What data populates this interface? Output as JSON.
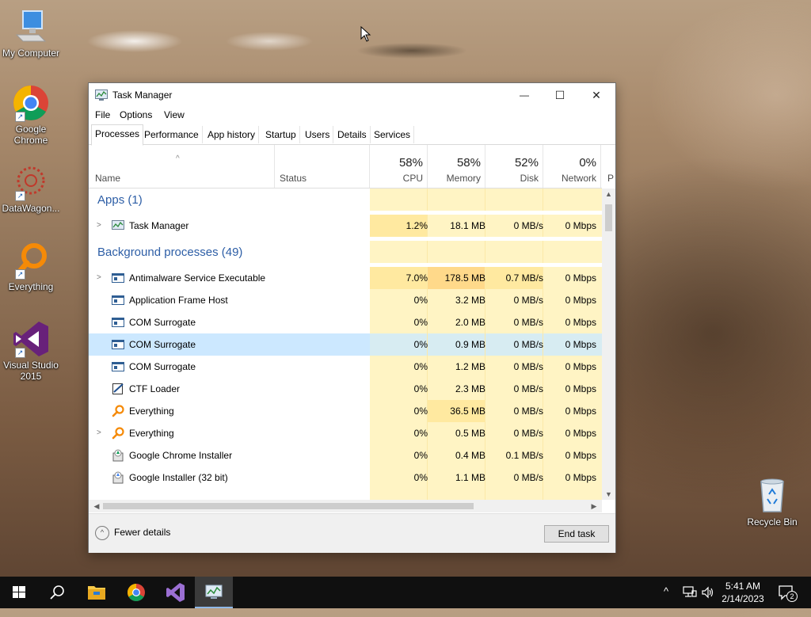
{
  "desktop": {
    "icons": [
      {
        "label": "My Computer"
      },
      {
        "label": "Google Chrome"
      },
      {
        "label": "DataWagon..."
      },
      {
        "label": "Everything"
      },
      {
        "label": "Visual Studio 2015"
      },
      {
        "label": "Recycle Bin"
      }
    ]
  },
  "window": {
    "title": "Task Manager",
    "icon": "task-manager-icon",
    "controls": {
      "minimize": "—",
      "maximize": "☐",
      "close": "✕"
    }
  },
  "menu": {
    "file": "File",
    "options": "Options",
    "view": "View"
  },
  "tabs": {
    "processes": "Processes",
    "performance": "Performance",
    "app_history": "App history",
    "startup": "Startup",
    "users": "Users",
    "details": "Details",
    "services": "Services"
  },
  "columns": {
    "name": "Name",
    "status": "Status",
    "cpu": {
      "pct": "58%",
      "label": "CPU"
    },
    "memory": {
      "pct": "58%",
      "label": "Memory"
    },
    "disk": {
      "pct": "52%",
      "label": "Disk"
    },
    "network": {
      "pct": "0%",
      "label": "Network"
    },
    "power_partial": "P"
  },
  "groups": {
    "apps": "Apps (1)",
    "background": "Background processes (49)"
  },
  "apps": [
    {
      "name": "Task Manager",
      "cpu": "1.2%",
      "memory": "18.1 MB",
      "disk": "0 MB/s",
      "network": "0 Mbps"
    }
  ],
  "processes": [
    {
      "name": "Antimalware Service Executable",
      "cpu": "7.0%",
      "memory": "178.5 MB",
      "disk": "0.7 MB/s",
      "network": "0 Mbps"
    },
    {
      "name": "Application Frame Host",
      "cpu": "0%",
      "memory": "3.2 MB",
      "disk": "0 MB/s",
      "network": "0 Mbps"
    },
    {
      "name": "COM Surrogate",
      "cpu": "0%",
      "memory": "2.0 MB",
      "disk": "0 MB/s",
      "network": "0 Mbps"
    },
    {
      "name": "COM Surrogate",
      "cpu": "0%",
      "memory": "0.9 MB",
      "disk": "0 MB/s",
      "network": "0 Mbps"
    },
    {
      "name": "COM Surrogate",
      "cpu": "0%",
      "memory": "1.2 MB",
      "disk": "0 MB/s",
      "network": "0 Mbps"
    },
    {
      "name": "CTF Loader",
      "cpu": "0%",
      "memory": "2.3 MB",
      "disk": "0 MB/s",
      "network": "0 Mbps"
    },
    {
      "name": "Everything",
      "cpu": "0%",
      "memory": "36.5 MB",
      "disk": "0 MB/s",
      "network": "0 Mbps"
    },
    {
      "name": "Everything",
      "cpu": "0%",
      "memory": "0.5 MB",
      "disk": "0 MB/s",
      "network": "0 Mbps"
    },
    {
      "name": "Google Chrome Installer",
      "cpu": "0%",
      "memory": "0.4 MB",
      "disk": "0.1 MB/s",
      "network": "0 Mbps"
    },
    {
      "name": "Google Installer (32 bit)",
      "cpu": "0%",
      "memory": "1.1 MB",
      "disk": "0 MB/s",
      "network": "0 Mbps"
    }
  ],
  "footer": {
    "fewer_details": "Fewer details",
    "end_task": "End task"
  },
  "taskbar": {
    "time": "5:41 AM",
    "date": "2/14/2023",
    "notification_count": "2"
  },
  "colors": {
    "group_header": "#2d5ea6",
    "heat_light": "#fff4c4",
    "selection": "#cce8ff",
    "accent": "#0078d7"
  }
}
